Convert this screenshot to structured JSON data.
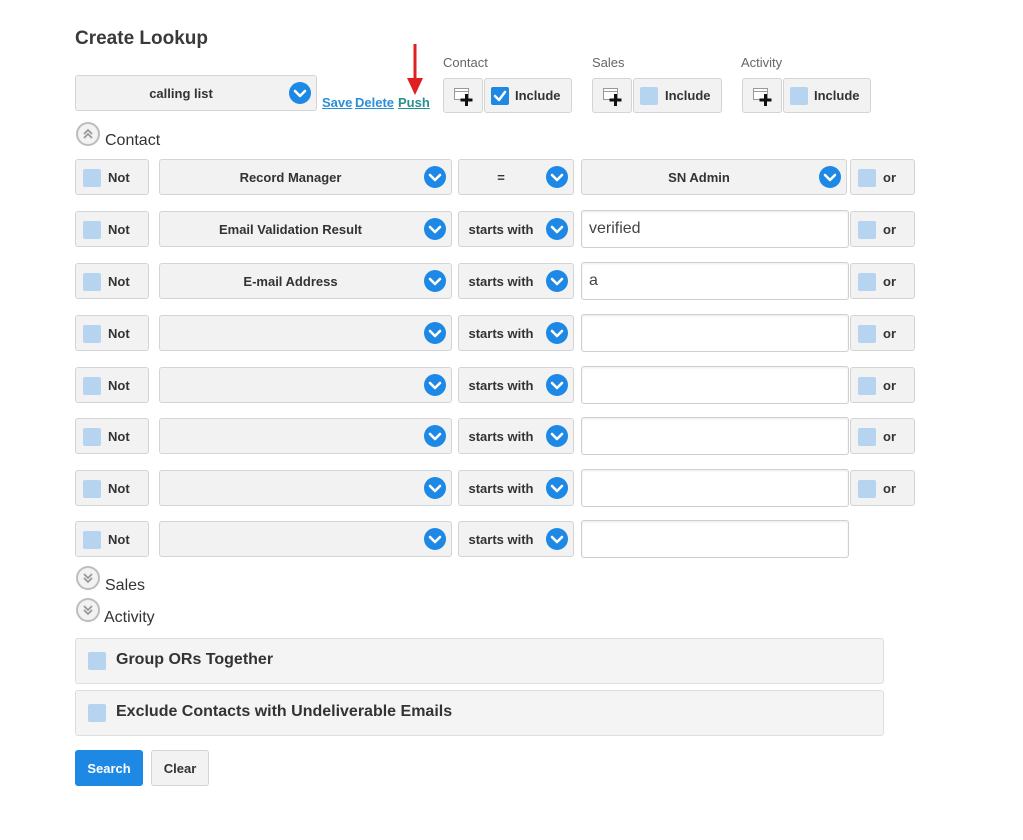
{
  "page_title": "Create Lookup",
  "lookup_select": {
    "value": "calling list"
  },
  "actions": {
    "save": "Save",
    "delete": "Delete",
    "push": "Push"
  },
  "groups": [
    {
      "name": "Contact",
      "include_label": "Include",
      "include_checked": true
    },
    {
      "name": "Sales",
      "include_label": "Include",
      "include_checked": false
    },
    {
      "name": "Activity",
      "include_label": "Include",
      "include_checked": false
    }
  ],
  "sections": {
    "contact": "Contact",
    "sales": "Sales",
    "activity": "Activity"
  },
  "not_label": "Not",
  "or_label": "or",
  "rows": [
    {
      "field": "Record Manager",
      "operator": "=",
      "value": "SN Admin",
      "value_is_select": true,
      "show_or": true
    },
    {
      "field": "Email Validation Result",
      "operator": "starts with",
      "value": "verified",
      "value_is_select": false,
      "show_or": true
    },
    {
      "field": "E-mail Address",
      "operator": "starts with",
      "value": "a",
      "value_is_select": false,
      "show_or": true
    },
    {
      "field": "",
      "operator": "starts with",
      "value": "",
      "value_is_select": false,
      "show_or": true
    },
    {
      "field": "",
      "operator": "starts with",
      "value": "",
      "value_is_select": false,
      "show_or": true
    },
    {
      "field": "",
      "operator": "starts with",
      "value": "",
      "value_is_select": false,
      "show_or": true
    },
    {
      "field": "",
      "operator": "starts with",
      "value": "",
      "value_is_select": false,
      "show_or": true
    },
    {
      "field": "",
      "operator": "starts with",
      "value": "",
      "value_is_select": false,
      "show_or": false
    }
  ],
  "options": {
    "group_ors": "Group ORs Together",
    "exclude_undeliverable": "Exclude Contacts with Undeliverable Emails"
  },
  "buttons": {
    "search": "Search",
    "clear": "Clear"
  },
  "colors": {
    "accent": "#1e88e5",
    "checkbox_off": "#b6d3ef",
    "arrow": "#e02020"
  },
  "icons": {
    "dropdown": "chevron-down-icon",
    "add_group": "add-table-icon",
    "collapse": "collapse-up-icon",
    "expand": "expand-down-icon",
    "annotation": "red-down-arrow"
  }
}
